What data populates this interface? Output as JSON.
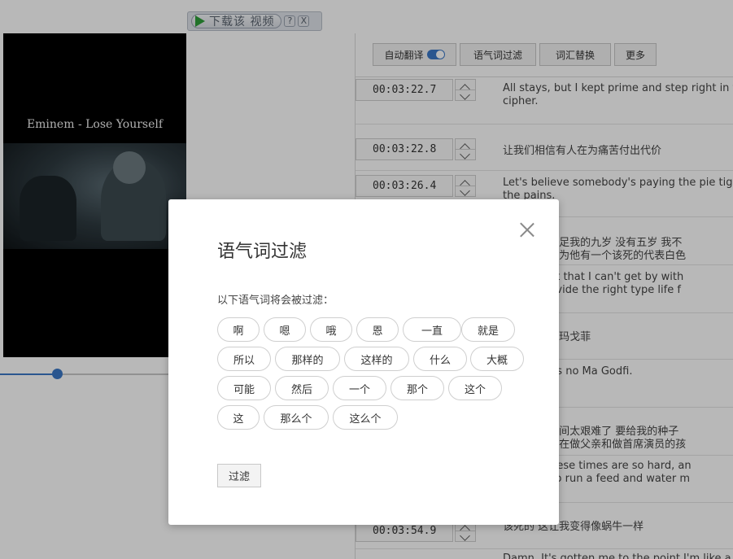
{
  "download_bar": {
    "label": "下载该 视频",
    "help": "?",
    "close": "X"
  },
  "video": {
    "title": "Eminem - Lose Yourself",
    "progress": 0.16
  },
  "toolbar": {
    "auto_translate": "自动翻译",
    "filler_filter": "语气词过滤",
    "vocab_replace": "词汇替换",
    "more": "更多"
  },
  "subtitles": [
    {
      "time": "00:03:22.7",
      "lines": [
        "All stays, but I kept prime and step right in the",
        "cipher."
      ]
    },
    {
      "time": "00:03:22.8",
      "lines": [
        "让我们相信有人在为痛苦付出代价"
      ]
    },
    {
      "time": "00:03:26.4",
      "lines": [
        "Let's believe somebody's paying the pie tight",
        "the pains."
      ]
    },
    {
      "time": "",
      "lines": [
        "实 我不能满足我的九岁 没有五岁 我不",
        "确的生活 因为他有一个该死的代表白色"
      ]
    },
    {
      "time": "",
      "lines": [
        "by the fact that I can't get by with",
        "I can't provide the right type life f"
      ]
    },
    {
      "time": "",
      "lines": [
        "摆脱 这不是玛戈菲"
      ]
    },
    {
      "time": "",
      "lines": [
        "one rid. It's no Ma Godfi."
      ]
    },
    {
      "time": "",
      "lines": [
        "生活 这段时间太艰难了 要给我的种子",
        "了 再加上要在做父亲和做首席演员的孩"
      ]
    },
    {
      "time": "",
      "lines": [
        "ife, and these times are so hard, an",
        "n harder to run a feed and water m"
      ]
    },
    {
      "time": "00:03:54.9",
      "lines": [
        "该死的 这让我变得像蜗牛一样"
      ]
    },
    {
      "time": "",
      "lines": [
        "Damn. It's gotten me to the point I'm like a s"
      ]
    }
  ],
  "modal": {
    "title": "语气词过滤",
    "description": "以下语气词将会被过滤：",
    "words": [
      "啊",
      "嗯",
      "哦",
      "恩",
      "一直",
      "就是",
      "所以",
      "那样的",
      "这样的",
      "什么",
      "大概",
      "可能",
      "然后",
      "一个",
      "那个",
      "这个",
      "这",
      "那么个",
      "这么个"
    ],
    "filter_button": "过滤"
  }
}
